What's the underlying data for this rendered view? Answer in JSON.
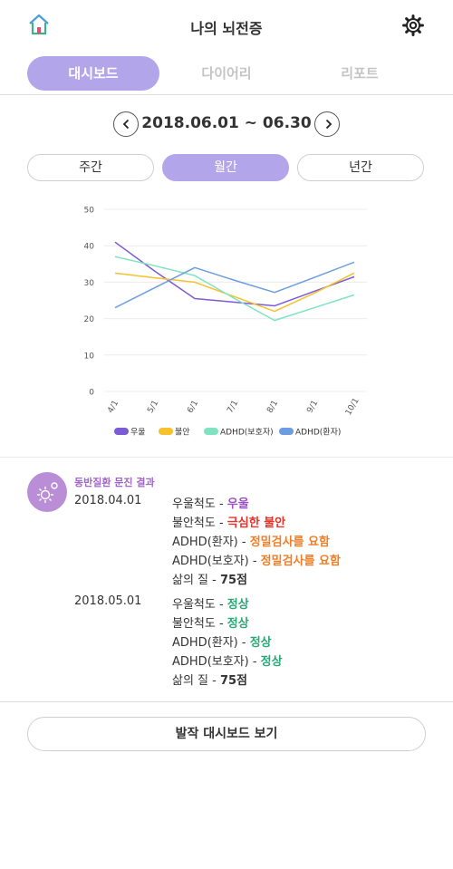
{
  "header": {
    "title": "나의 뇌전증",
    "home_icon": "home-icon",
    "settings_icon": "gear-icon"
  },
  "tabs": [
    {
      "label": "대시보드",
      "active": true
    },
    {
      "label": "다이어리",
      "active": false
    },
    {
      "label": "리포트",
      "active": false
    }
  ],
  "date_nav": {
    "range": "2018.06.01 ~ 06.30"
  },
  "period_tabs": [
    {
      "label": "주간",
      "active": false
    },
    {
      "label": "월간",
      "active": true
    },
    {
      "label": "년간",
      "active": false
    }
  ],
  "chart_data": {
    "type": "line",
    "categories": [
      "4/1",
      "5/1",
      "6/1",
      "7/1",
      "8/1",
      "9/1",
      "10/1"
    ],
    "ylim": [
      0,
      50
    ],
    "yticks": [
      "0",
      "10",
      "20",
      "30",
      "40",
      "50"
    ],
    "grid": true,
    "legend_position": "bottom",
    "series": [
      {
        "name": "우울",
        "color": "#7b5bd6",
        "values": [
          41,
          33,
          25.5,
          24.5,
          23.5,
          27.5,
          31.5
        ]
      },
      {
        "name": "불안",
        "color": "#f5c12c",
        "values": [
          32.5,
          31.2,
          30,
          26,
          22,
          27,
          32.5
        ]
      },
      {
        "name": "ADHD(보호자)",
        "color": "#7ee3c0",
        "values": [
          37,
          34.5,
          31.8,
          25.5,
          19.5,
          23,
          26.5
        ]
      },
      {
        "name": "ADHD(환자)",
        "color": "#6b9de0",
        "values": [
          23,
          28.5,
          34,
          30.5,
          27.2,
          31.3,
          35.5
        ]
      }
    ]
  },
  "results": {
    "title": "동반질환 문진 결과",
    "entries": [
      {
        "date": "2018.04.01",
        "lines": [
          {
            "label": "우울척도 - ",
            "value": "우울",
            "color": "#9c4fc9"
          },
          {
            "label": "불안척도 - ",
            "value": "극심한 불안",
            "color": "#e5332a"
          },
          {
            "label": "ADHD(환자) - ",
            "value": "정밀검사를 요함",
            "color": "#f07e26"
          },
          {
            "label": "ADHD(보호자) - ",
            "value": "정밀검사를 요함",
            "color": "#f07e26"
          },
          {
            "label": "삶의 질 - ",
            "value": "75점",
            "color": "#333333"
          }
        ]
      },
      {
        "date": "2018.05.01",
        "lines": [
          {
            "label": "우울척도 - ",
            "value": "정상",
            "color": "#2aa876"
          },
          {
            "label": "불안척도 - ",
            "value": "정상",
            "color": "#2aa876"
          },
          {
            "label": "ADHD(환자) - ",
            "value": "정상",
            "color": "#2aa876"
          },
          {
            "label": "ADHD(보호자) - ",
            "value": "정상",
            "color": "#2aa876"
          },
          {
            "label": "삶의 질 - ",
            "value": "75점",
            "color": "#333333"
          }
        ]
      }
    ]
  },
  "bottom_button": {
    "label": "발작 대시보드 보기"
  }
}
